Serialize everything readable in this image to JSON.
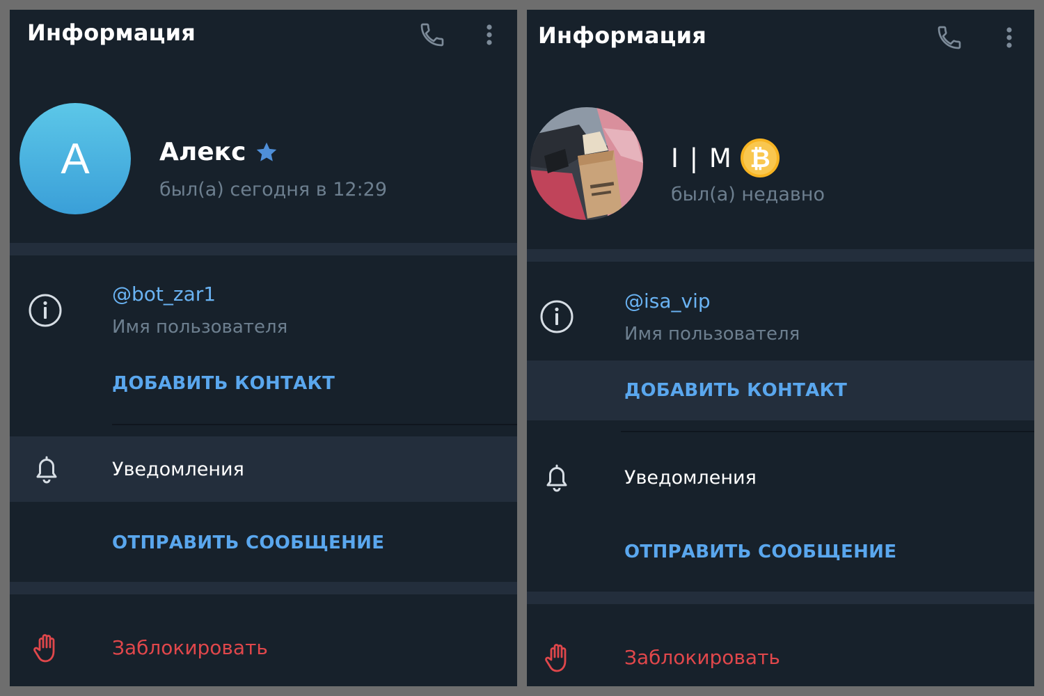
{
  "colors": {
    "panel_bg": "#17212b",
    "section_gap": "#232e3c",
    "accent_blue": "#5aa7ee",
    "muted_text": "#6d7f8f",
    "danger_red": "#e0474b"
  },
  "left_panel": {
    "header": {
      "title": "Информация",
      "call_icon": "phone-icon",
      "more_icon": "more-vert-icon"
    },
    "profile": {
      "avatar_letter": "A",
      "name": "Алекс",
      "badge_icon": "star-icon",
      "status": "был(а) сегодня в 12:29"
    },
    "info": {
      "username": "@bot_zar1",
      "username_label": "Имя пользователя",
      "add_contact": "ДОБАВИТЬ КОНТАКТ"
    },
    "notifications": {
      "label": "Уведомления"
    },
    "send_message": {
      "label": "ОТПРАВИТЬ СООБЩЕНИЕ"
    },
    "block": {
      "label": "Заблокировать"
    }
  },
  "right_panel": {
    "header": {
      "title": "Информация",
      "call_icon": "phone-icon",
      "more_icon": "more-vert-icon"
    },
    "profile": {
      "avatar_image": "photo of a paper bag in a car",
      "name": "I | M",
      "badge_icon": "bitcoin-icon",
      "status": "был(а) недавно"
    },
    "info": {
      "username": "@isa_vip",
      "username_label": "Имя пользователя",
      "add_contact": "ДОБАВИТЬ КОНТАКТ"
    },
    "notifications": {
      "label": "Уведомления"
    },
    "send_message": {
      "label": "ОТПРАВИТЬ СООБЩЕНИЕ"
    },
    "block": {
      "label": "Заблокировать"
    }
  }
}
